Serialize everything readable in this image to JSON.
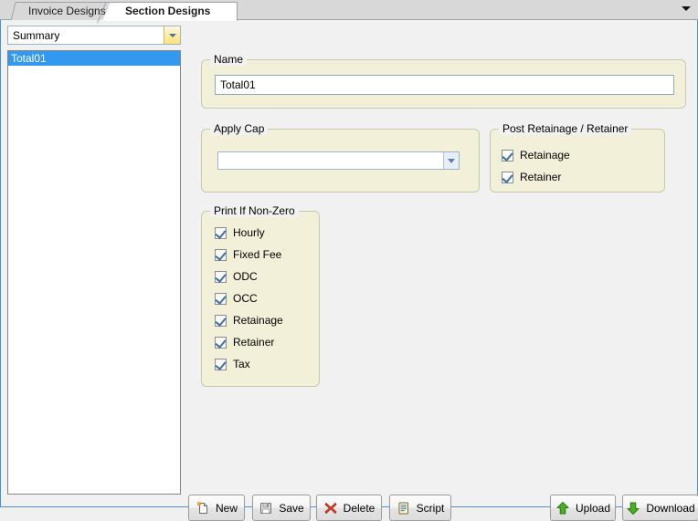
{
  "tabs": [
    {
      "label": "Invoice Designs",
      "active": false
    },
    {
      "label": "Section Designs",
      "active": true
    }
  ],
  "tab_overflow_icon": "chevron-down-icon",
  "sidebar": {
    "category_combo": {
      "value": "Summary",
      "arrow_icon": "chevron-down-icon"
    },
    "list_items": [
      {
        "label": "Total01",
        "selected": true
      }
    ]
  },
  "groups": {
    "name": {
      "title": "Name",
      "input_value": "Total01",
      "input_placeholder": ""
    },
    "apply_cap": {
      "title": "Apply Cap",
      "combo_value": "",
      "combo_placeholder": "",
      "arrow_icon": "chevron-down-icon"
    },
    "post_retainage_retainer": {
      "title": "Post Retainage / Retainer",
      "checkboxes": [
        {
          "label": "Retainage",
          "checked": true
        },
        {
          "label": "Retainer",
          "checked": true
        }
      ]
    },
    "print_if_non_zero": {
      "title": "Print If Non-Zero",
      "checkboxes": [
        {
          "label": "Hourly",
          "checked": true
        },
        {
          "label": "Fixed Fee",
          "checked": true
        },
        {
          "label": "ODC",
          "checked": true
        },
        {
          "label": "OCC",
          "checked": true
        },
        {
          "label": "Retainage",
          "checked": true
        },
        {
          "label": "Retainer",
          "checked": true
        },
        {
          "label": "Tax",
          "checked": true
        }
      ]
    }
  },
  "toolbar": {
    "new_label": "New",
    "save_label": "Save",
    "delete_label": "Delete",
    "script_label": "Script",
    "upload_label": "Upload",
    "download_label": "Download"
  },
  "colors": {
    "accent_blue": "#4a90d9",
    "selection_blue": "#3399ee",
    "group_background": "#f2f0d8",
    "panel_background": "#f1f1f1",
    "upload_green": "#4caf26",
    "delete_red": "#d33a2c"
  }
}
